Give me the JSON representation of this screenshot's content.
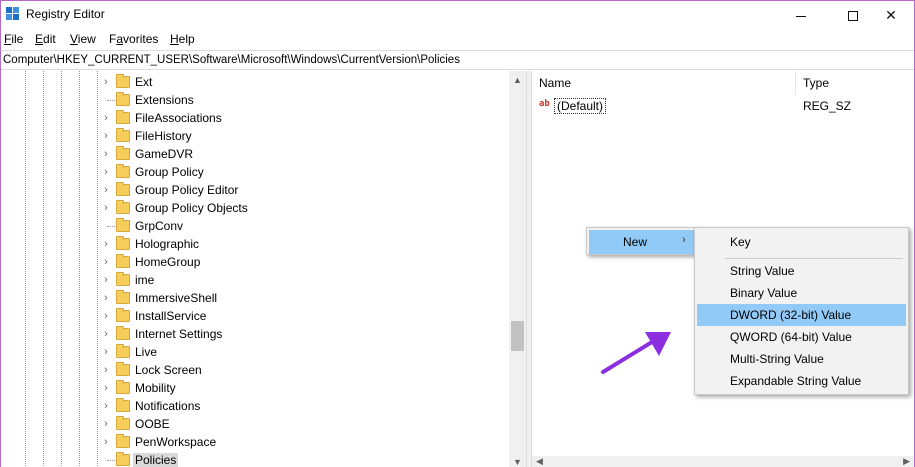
{
  "window": {
    "title": "Registry Editor",
    "controls": {
      "minimize": "minimize",
      "maximize": "maximize",
      "close": "✕"
    }
  },
  "menubar": {
    "items": [
      {
        "underline": "F",
        "rest": "ile"
      },
      {
        "underline": "E",
        "rest": "dit"
      },
      {
        "underline": "V",
        "rest": "iew"
      },
      {
        "underline": "",
        "pre": "F",
        "u2": "a",
        "rest": "vorites"
      },
      {
        "underline": "H",
        "rest": "elp"
      }
    ]
  },
  "address": {
    "path": "Computer\\HKEY_CURRENT_USER\\Software\\Microsoft\\Windows\\CurrentVersion\\Policies"
  },
  "tree": {
    "items": [
      {
        "label": "Ext",
        "expandable": true
      },
      {
        "label": "Extensions",
        "expandable": false
      },
      {
        "label": "FileAssociations",
        "expandable": true
      },
      {
        "label": "FileHistory",
        "expandable": true
      },
      {
        "label": "GameDVR",
        "expandable": true
      },
      {
        "label": "Group Policy",
        "expandable": true
      },
      {
        "label": "Group Policy Editor",
        "expandable": true
      },
      {
        "label": "Group Policy Objects",
        "expandable": true
      },
      {
        "label": "GrpConv",
        "expandable": false
      },
      {
        "label": "Holographic",
        "expandable": true
      },
      {
        "label": "HomeGroup",
        "expandable": true
      },
      {
        "label": "ime",
        "expandable": true
      },
      {
        "label": "ImmersiveShell",
        "expandable": true
      },
      {
        "label": "InstallService",
        "expandable": true
      },
      {
        "label": "Internet Settings",
        "expandable": true
      },
      {
        "label": "Live",
        "expandable": true
      },
      {
        "label": "Lock Screen",
        "expandable": true
      },
      {
        "label": "Mobility",
        "expandable": true
      },
      {
        "label": "Notifications",
        "expandable": true
      },
      {
        "label": "OOBE",
        "expandable": true
      },
      {
        "label": "PenWorkspace",
        "expandable": true
      },
      {
        "label": "Policies",
        "expandable": false,
        "selected": true
      }
    ]
  },
  "values": {
    "columns": {
      "name": "Name",
      "type": "Type"
    },
    "rows": [
      {
        "icon": "ab",
        "name": "(Default)",
        "type": "REG_SZ"
      }
    ]
  },
  "context_menu": {
    "new_label": "New",
    "new_arrow": "›",
    "submenu": [
      {
        "label": "Key"
      },
      {
        "label": "String Value"
      },
      {
        "label": "Binary Value"
      },
      {
        "label": "DWORD (32-bit) Value",
        "highlighted": true
      },
      {
        "label": "QWORD (64-bit) Value"
      },
      {
        "label": "Multi-String Value"
      },
      {
        "label": "Expandable String Value"
      }
    ]
  },
  "colors": {
    "highlight": "#91c9f7",
    "annotation_arrow": "#8b2fe0",
    "window_border": "#b66ac8"
  }
}
